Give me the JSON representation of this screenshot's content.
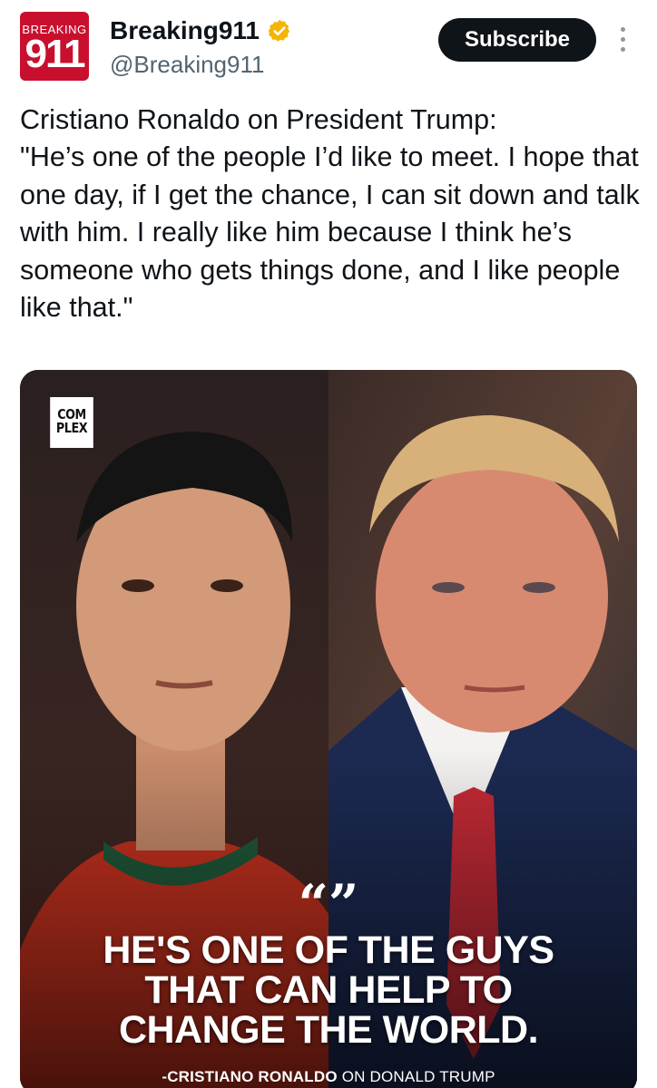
{
  "account": {
    "avatar_top": "BREAKING",
    "avatar_main": "911",
    "display_name": "Breaking911",
    "handle": "@Breaking911",
    "verified_icon": "verified-gold-badge-icon",
    "verified_color": "#f4b400"
  },
  "actions": {
    "subscribe_label": "Subscribe",
    "more_icon": "vertical-ellipsis-icon"
  },
  "post": {
    "text": "Cristiano Ronaldo on President Trump:\n \"He’s one of the people I’d like to meet. I hope that one day, if I get the chance, I can sit down and talk with him. I really like him because I think he’s someone who gets things done, and I like people like that.\""
  },
  "media": {
    "logo": "COM\nPLEX",
    "quote_mark": "“”",
    "headline": "HE'S ONE OF THE GUYS\nTHAT CAN HELP TO\nCHANGE THE WORLD.",
    "attribution_name": "-CRISTIANO RONALDO",
    "attribution_rest": " ON DONALD TRUMP"
  },
  "colors": {
    "avatar_red": "#c8102e",
    "button_bg": "#0f1419",
    "secondary_text": "#536471"
  }
}
